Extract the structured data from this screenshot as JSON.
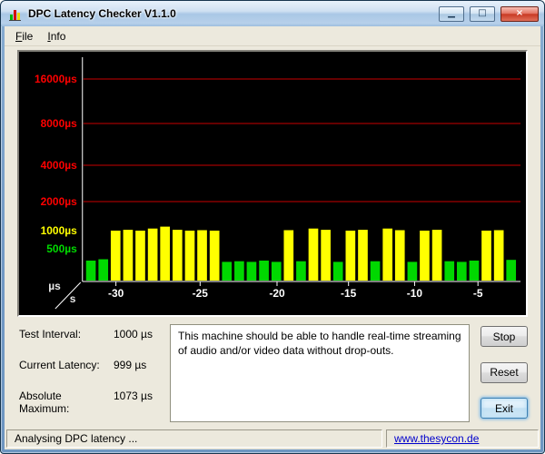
{
  "window": {
    "title": "DPC Latency Checker V1.1.0",
    "controls": [
      {
        "name": "minimize",
        "glyph": "▁"
      },
      {
        "name": "maximize",
        "glyph": "□"
      },
      {
        "name": "close",
        "glyph": "×"
      }
    ]
  },
  "menu": {
    "items": [
      {
        "label": "File"
      },
      {
        "label": "Info"
      }
    ]
  },
  "chart_data": {
    "type": "bar",
    "plot_bg": "#000000",
    "axis_color": "#ffffff",
    "gridline_color": "#c80000",
    "axis_units": {
      "y": "µs",
      "x": "s"
    },
    "y_scale": "logarithmic above 500µs",
    "y_ticks": [
      {
        "label": "16000µs",
        "value": 16000,
        "color": "#ff0000",
        "gridline": true
      },
      {
        "label": "8000µs",
        "value": 8000,
        "color": "#ff0000",
        "gridline": true
      },
      {
        "label": "4000µs",
        "value": 4000,
        "color": "#ff0000",
        "gridline": true
      },
      {
        "label": "2000µs",
        "value": 2000,
        "color": "#ff0000",
        "gridline": true
      },
      {
        "label": "1000µs",
        "value": 1000,
        "color": "#ffff00",
        "gridline": false
      },
      {
        "label": "500µs",
        "value": 500,
        "color": "#00dc00",
        "gridline": false
      }
    ],
    "x_tick_labels": [
      "-30",
      "-25",
      "-20",
      "-15",
      "-10",
      "-5"
    ],
    "thresholds_us": {
      "low_max": 500,
      "mid_max": 2000
    },
    "bar_colors": {
      "low": "#00d800",
      "mid": "#ffff00",
      "high": "#ff0000"
    },
    "values_us": [
      320,
      340,
      1000,
      1020,
      1000,
      1050,
      1100,
      1020,
      1000,
      1010,
      1000,
      300,
      310,
      300,
      320,
      300,
      1010,
      310,
      1050,
      1020,
      300,
      1000,
      1020,
      310,
      1050,
      1010,
      300,
      1000,
      1020,
      310,
      300,
      320,
      1000,
      1010,
      330
    ]
  },
  "info": {
    "rows": [
      {
        "label": "Test Interval:",
        "value": "1000 µs"
      },
      {
        "label": "Current Latency:",
        "value": "999 µs"
      },
      {
        "label": "Absolute Maximum:",
        "value": "1073 µs"
      }
    ],
    "message": "This machine should be able to handle real-time streaming of audio and/or video data without drop-outs.",
    "buttons": [
      {
        "label": "Stop"
      },
      {
        "label": "Reset"
      },
      {
        "label": "Exit"
      }
    ]
  },
  "status": {
    "text": "Analysing DPC latency ...",
    "link": "www.thesycon.de"
  }
}
